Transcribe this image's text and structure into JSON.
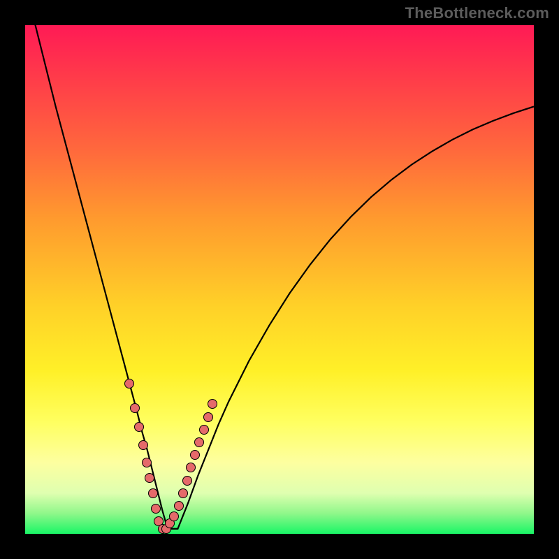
{
  "watermark": "TheBottleneck.com",
  "colors": {
    "curve": "#000000",
    "dot_fill": "#e56a6a",
    "dot_stroke": "#000000",
    "background_black": "#000000"
  },
  "chart_data": {
    "type": "line",
    "title": "",
    "xlabel": "",
    "ylabel": "",
    "xlim": [
      0,
      100
    ],
    "ylim": [
      0,
      100
    ],
    "grid": false,
    "legend": false,
    "series": [
      {
        "name": "bottleneck-curve",
        "x": [
          0,
          2,
          4,
          6,
          8,
          10,
          12,
          14,
          16,
          18,
          20,
          22,
          23,
          24,
          25,
          26,
          27,
          28,
          30,
          32,
          34,
          36,
          38,
          40,
          44,
          48,
          52,
          56,
          60,
          64,
          68,
          72,
          76,
          80,
          84,
          88,
          92,
          96,
          100
        ],
        "y": [
          108,
          100,
          92,
          84,
          76.5,
          69,
          61.5,
          54,
          46.5,
          39,
          31.5,
          24,
          20,
          16.5,
          12.5,
          8.5,
          4.5,
          1,
          1,
          6,
          11.5,
          16.5,
          21.5,
          26,
          34,
          41,
          47.3,
          52.9,
          57.9,
          62.3,
          66.2,
          69.6,
          72.6,
          75.2,
          77.5,
          79.5,
          81.2,
          82.7,
          84
        ]
      }
    ],
    "scatter": [
      {
        "name": "sample-points",
        "x": [
          20.5,
          21.6,
          22.4,
          23.2,
          23.9,
          24.5,
          25.1,
          25.7,
          26.3,
          27.0,
          27.7,
          28.5,
          29.3,
          30.2,
          31.0,
          31.8,
          32.6,
          33.4,
          34.2,
          35.1,
          36.0,
          36.8
        ],
        "y": [
          29.5,
          24.7,
          21.0,
          17.5,
          14.0,
          11.0,
          8.0,
          5.0,
          2.5,
          1.0,
          1.0,
          2.0,
          3.5,
          5.5,
          8.0,
          10.5,
          13.0,
          15.5,
          18.0,
          20.5,
          23.0,
          25.5
        ]
      }
    ]
  }
}
